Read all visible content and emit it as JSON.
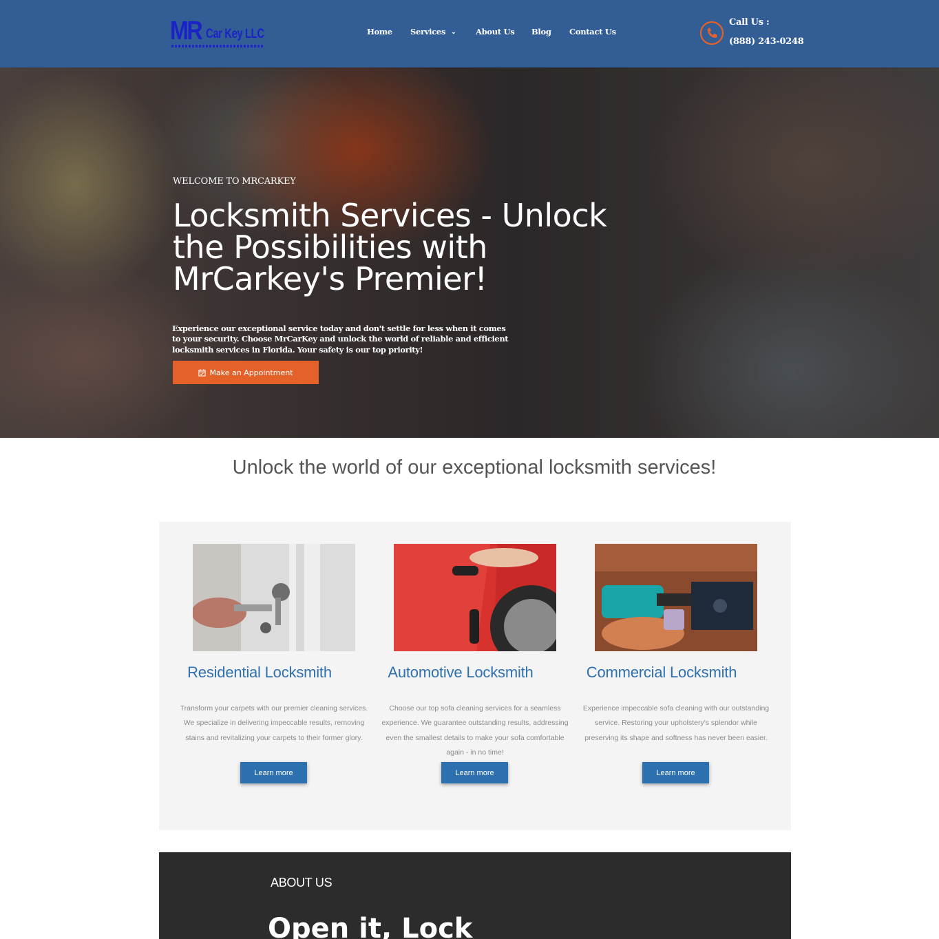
{
  "header": {
    "logo": {
      "mr": "MR",
      "name": "Car Key LLC"
    },
    "nav": [
      {
        "label": "Home"
      },
      {
        "label": "Services"
      },
      {
        "label": "About Us"
      },
      {
        "label": "Blog"
      },
      {
        "label": "Contact Us"
      }
    ],
    "call_label": "Call Us :",
    "call_number": "(888) 243-0248"
  },
  "hero": {
    "eyebrow": "WELCOME TO MRCARKEY",
    "title": "Locksmith Services - Unlock the Possibilities with MrCarkey's Premier!",
    "text": "Experience our exceptional service today and don't settle for less when it comes to your security. Choose MrCarKey and unlock the world of reliable and efficient locksmith services in Florida. Your safety is our top priority!",
    "button_label": "Make an Appointment"
  },
  "services": {
    "heading": "Unlock the world of our exceptional locksmith services!",
    "cards": [
      {
        "title": "Residential Locksmith",
        "description": "Transform your carpets with our premier cleaning services. We specialize in delivering impeccable results, removing stains and revitalizing your carpets to their former glory.",
        "button_label": "Learn more"
      },
      {
        "title": "Automotive Locksmith",
        "description": "Choose our top sofa cleaning services for a seamless experience. We guarantee outstanding results, addressing even the smallest details to make your sofa comfortable again - in no time!",
        "button_label": "Learn more"
      },
      {
        "title": "Commercial Locksmith",
        "description": "Experience impeccable sofa cleaning with our outstanding service. Restoring your upholstery's splendor while preserving its shape and softness has never been easier.",
        "button_label": "Learn more"
      }
    ]
  },
  "about": {
    "label": "ABOUT US",
    "title": "Open it, Lock"
  },
  "colors": {
    "header_bg": "#335e95",
    "accent_orange": "#e4612a",
    "link_blue": "#2d70b0",
    "about_bg": "#2c2c2c"
  },
  "icons": {
    "phone": "phone-icon",
    "calendar": "calendar-icon",
    "chevron": "chevron-down-icon"
  }
}
